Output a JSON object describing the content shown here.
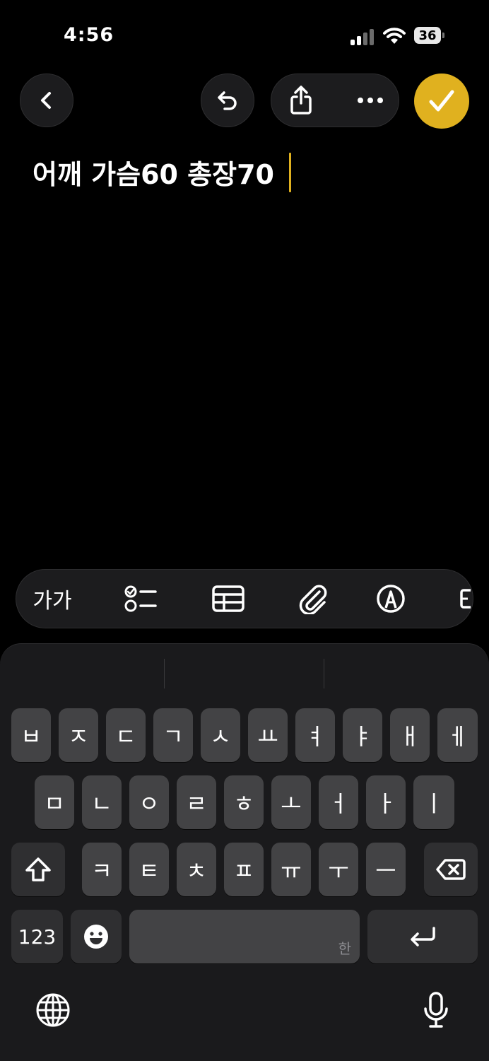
{
  "status_bar": {
    "time": "4:56",
    "battery_level": "36"
  },
  "nav": {
    "back_icon": "chevron-left-icon",
    "undo_icon": "undo-icon",
    "share_icon": "share-icon",
    "more_icon": "ellipsis-icon",
    "done_icon": "checkmark-icon",
    "accent_color": "#e0b11f"
  },
  "note": {
    "text": "어깨 가슴60 총장70"
  },
  "format_bar": {
    "text_style_label": "가가",
    "checklist_icon": "checklist-icon",
    "table_icon": "table-icon",
    "attachment_icon": "paperclip-icon",
    "markup_icon": "markup-pen-icon"
  },
  "keyboard": {
    "row1": [
      "ㅂ",
      "ㅈ",
      "ㄷ",
      "ㄱ",
      "ㅅ",
      "ㅛ",
      "ㅕ",
      "ㅑ",
      "ㅐ",
      "ㅔ"
    ],
    "row2": [
      "ㅁ",
      "ㄴ",
      "ㅇ",
      "ㄹ",
      "ㅎ",
      "ㅗ",
      "ㅓ",
      "ㅏ",
      "ㅣ"
    ],
    "row3": [
      "ㅋ",
      "ㅌ",
      "ㅊ",
      "ㅍ",
      "ㅠ",
      "ㅜ",
      "ㅡ"
    ],
    "numbers_label": "123",
    "space_hint": "한",
    "shift_icon": "shift-icon",
    "delete_icon": "backspace-icon",
    "emoji_icon": "emoji-icon",
    "return_icon": "return-icon",
    "globe_icon": "globe-icon",
    "mic_icon": "microphone-icon"
  }
}
